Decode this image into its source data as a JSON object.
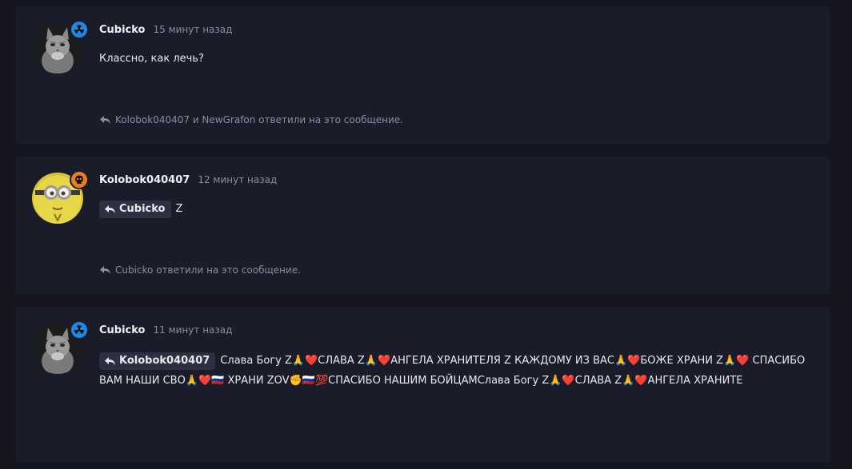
{
  "posts": [
    {
      "username": "Cubicko",
      "time": "15 минут назад",
      "text": "Классно, как лечь?",
      "badge_icon": "radiation-icon",
      "badge_color": "#1e88e5",
      "replies_text": "Kolobok040407 и NewGrafon ответили на это сообщение."
    },
    {
      "username": "Kolobok040407",
      "time": "12 минут назад",
      "quote_label": "Cubicko",
      "text": "Z",
      "badge_icon": "skull-icon",
      "badge_color": "#e67e22",
      "replies_text": "Cubicko ответили на это сообщение."
    },
    {
      "username": "Cubicko",
      "time": "11 минут назад",
      "quote_label": "Kolobok040407",
      "text": "Слава Богу Z🙏❤️СЛАВА Z🙏❤️АНГЕЛА ХРАНИТЕЛЯ Z КАЖДОМУ ИЗ ВАС🙏❤️БОЖЕ ХРАНИ Z🙏❤️ СПАСИБО ВАМ НАШИ СВО🙏❤️🇷🇺 ХРАНИ ZOV✊🇷🇺💯СПАСИБО НАШИМ БОЙЦАМСлава Богу Z🙏❤️СЛАВА Z🙏❤️АНГЕЛА ХРАНИТЕ",
      "badge_icon": "radiation-icon",
      "badge_color": "#1e88e5"
    }
  ]
}
